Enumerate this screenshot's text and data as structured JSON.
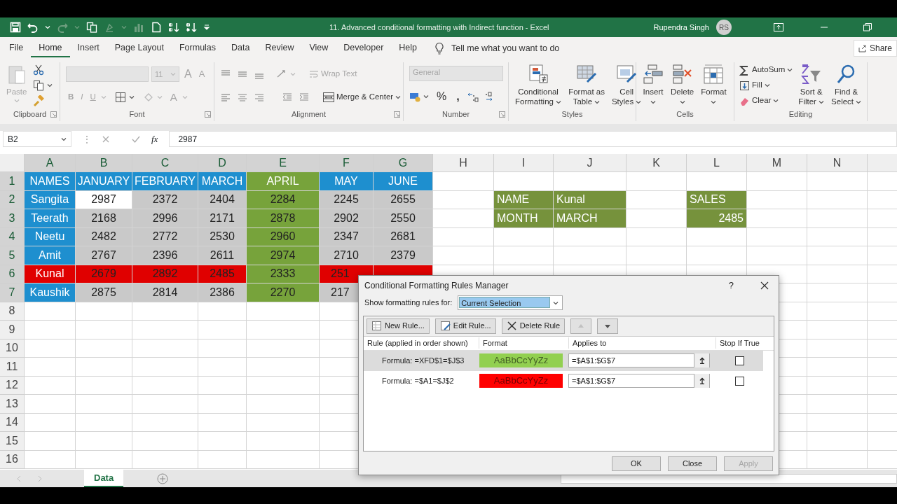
{
  "window": {
    "title": "11. Advanced conditional formatting with Indirect function  -  Excel",
    "user": "Rupendra Singh",
    "avatar": "RS"
  },
  "quick_access": [
    {
      "kind": "save",
      "disabled": false
    },
    {
      "kind": "undo",
      "disabled": false
    },
    {
      "kind": "caret",
      "disabled": false
    },
    {
      "kind": "redo",
      "disabled": true
    },
    {
      "kind": "caret",
      "disabled": true
    },
    {
      "kind": "copy",
      "disabled": false
    },
    {
      "kind": "brush",
      "disabled": true
    },
    {
      "kind": "caret",
      "disabled": true
    },
    {
      "kind": "chart",
      "disabled": true
    },
    {
      "kind": "page",
      "disabled": false
    },
    {
      "kind": "sort-up",
      "disabled": false
    },
    {
      "kind": "sort-down",
      "disabled": false
    },
    {
      "kind": "more",
      "disabled": false
    }
  ],
  "tabs": [
    {
      "label": "File",
      "selected": false
    },
    {
      "label": "Home",
      "selected": true
    },
    {
      "label": "Insert",
      "selected": false
    },
    {
      "label": "Page Layout",
      "selected": false
    },
    {
      "label": "Formulas",
      "selected": false
    },
    {
      "label": "Data",
      "selected": false
    },
    {
      "label": "Review",
      "selected": false
    },
    {
      "label": "View",
      "selected": false
    },
    {
      "label": "Developer",
      "selected": false
    },
    {
      "label": "Help",
      "selected": false
    }
  ],
  "tell_me": "Tell me what you want to do",
  "share": "Share",
  "ribbon": {
    "clipboard": {
      "label": "Clipboard",
      "paste": {
        "label": "Paste",
        "disabled": true
      }
    },
    "font": {
      "label": "Font",
      "size": "11",
      "grow": "A",
      "shrink": "A",
      "bold": "B",
      "italic": "I",
      "underline": "U",
      "font_color": "A"
    },
    "alignment": {
      "label": "Alignment",
      "wrap_text": {
        "label": "Wrap Text",
        "disabled": true
      },
      "merge": {
        "label": "Merge & Center",
        "disabled": false
      }
    },
    "number": {
      "label": "Number",
      "format": {
        "value": "General",
        "disabled": true
      },
      "percent": "%",
      "comma": ","
    },
    "styles": {
      "label": "Styles",
      "buttons": [
        {
          "kind": "conditional",
          "lines": [
            "Conditional",
            "Formatting"
          ]
        },
        {
          "kind": "table",
          "lines": [
            "Format as",
            "Table"
          ]
        },
        {
          "kind": "cellstyle",
          "lines": [
            "Cell",
            "Styles"
          ]
        }
      ]
    },
    "cells": {
      "label": "Cells",
      "buttons": [
        {
          "kind": "insert",
          "label": "Insert"
        },
        {
          "kind": "delete",
          "label": "Delete"
        },
        {
          "kind": "format",
          "label": "Format"
        }
      ]
    },
    "editing": {
      "label": "Editing",
      "small": [
        {
          "kind": "autosum",
          "label": "AutoSum"
        },
        {
          "kind": "fill",
          "label": "Fill"
        },
        {
          "kind": "clear",
          "label": "Clear"
        }
      ],
      "buttons": [
        {
          "kind": "sort",
          "lines": [
            "Sort &",
            "Filter"
          ]
        },
        {
          "kind": "find",
          "lines": [
            "Find &",
            "Select"
          ]
        }
      ]
    }
  },
  "formula_bar": {
    "name_box": "B2",
    "handle": "⋮",
    "fx": "fx",
    "value": "2987"
  },
  "sheet": {
    "columns": [
      {
        "label": "A",
        "selected": true
      },
      {
        "label": "B",
        "selected": true
      },
      {
        "label": "C",
        "selected": true
      },
      {
        "label": "D",
        "selected": true
      },
      {
        "label": "E",
        "selected": true
      },
      {
        "label": "F",
        "selected": true
      },
      {
        "label": "G",
        "selected": true
      },
      {
        "label": "H",
        "selected": false
      },
      {
        "label": "I",
        "selected": false
      },
      {
        "label": "J",
        "selected": false
      },
      {
        "label": "K",
        "selected": false
      },
      {
        "label": "L",
        "selected": false
      },
      {
        "label": "M",
        "selected": false
      },
      {
        "label": "N",
        "selected": false
      }
    ],
    "rows": [
      {
        "label": "1",
        "selected": true,
        "cells": [
          {
            "text": "NAMES",
            "kind": "head",
            "color": "#1e8fcf"
          },
          {
            "text": "JANUARY",
            "kind": "head",
            "color": "#1e8fcf"
          },
          {
            "text": "FEBRUARY",
            "kind": "head",
            "color": "#1e8fcf"
          },
          {
            "text": "MARCH",
            "kind": "head",
            "color": "#1e8fcf"
          },
          {
            "text": "APRIL",
            "kind": "head",
            "color": "#77a33b"
          },
          {
            "text": "MAY",
            "kind": "head",
            "color": "#1e8fcf"
          },
          {
            "text": "JUNE",
            "kind": "head",
            "color": "#1e8fcf"
          }
        ]
      },
      {
        "label": "2",
        "selected": true,
        "cells": [
          {
            "text": "Sangita",
            "kind": "head",
            "color": "#1e8fcf"
          },
          {
            "text": "2987",
            "kind": "num",
            "color": "#ffffff"
          },
          {
            "text": "2372",
            "kind": "num",
            "color": "#c9c9c9"
          },
          {
            "text": "2404",
            "kind": "num",
            "color": "#c9c9c9"
          },
          {
            "text": "2284",
            "kind": "num",
            "color": "#77a33b"
          },
          {
            "text": "2245",
            "kind": "num",
            "color": "#c9c9c9"
          },
          {
            "text": "2655",
            "kind": "num",
            "color": "#c9c9c9"
          },
          {},
          {
            "text": "NAME",
            "kind": "text",
            "color": "#76923c"
          },
          {
            "text": "Kunal",
            "kind": "text",
            "color": "#76923c"
          },
          {},
          {
            "text": "SALES",
            "kind": "text",
            "color": "#76923c"
          }
        ]
      },
      {
        "label": "3",
        "selected": true,
        "cells": [
          {
            "text": "Teerath",
            "kind": "head",
            "color": "#1e8fcf"
          },
          {
            "text": "2168",
            "kind": "num",
            "color": "#c9c9c9"
          },
          {
            "text": "2996",
            "kind": "num",
            "color": "#c9c9c9"
          },
          {
            "text": "2171",
            "kind": "num",
            "color": "#c9c9c9"
          },
          {
            "text": "2878",
            "kind": "num",
            "color": "#77a33b"
          },
          {
            "text": "2902",
            "kind": "num",
            "color": "#c9c9c9"
          },
          {
            "text": "2550",
            "kind": "num",
            "color": "#c9c9c9"
          },
          {},
          {
            "text": "MONTH",
            "kind": "text",
            "color": "#76923c"
          },
          {
            "text": "MARCH",
            "kind": "text",
            "color": "#76923c"
          },
          {},
          {
            "text": "2485",
            "kind": "value",
            "color": "#76923c"
          }
        ]
      },
      {
        "label": "4",
        "selected": true,
        "cells": [
          {
            "text": "Neetu",
            "kind": "head",
            "color": "#1e8fcf"
          },
          {
            "text": "2482",
            "kind": "num",
            "color": "#c9c9c9"
          },
          {
            "text": "2772",
            "kind": "num",
            "color": "#c9c9c9"
          },
          {
            "text": "2530",
            "kind": "num",
            "color": "#c9c9c9"
          },
          {
            "text": "2960",
            "kind": "num",
            "color": "#77a33b"
          },
          {
            "text": "2347",
            "kind": "num",
            "color": "#c9c9c9"
          },
          {
            "text": "2681",
            "kind": "num",
            "color": "#c9c9c9"
          }
        ]
      },
      {
        "label": "5",
        "selected": true,
        "cells": [
          {
            "text": "Amit",
            "kind": "head",
            "color": "#1e8fcf"
          },
          {
            "text": "2767",
            "kind": "num",
            "color": "#c9c9c9"
          },
          {
            "text": "2396",
            "kind": "num",
            "color": "#c9c9c9"
          },
          {
            "text": "2611",
            "kind": "num",
            "color": "#c9c9c9"
          },
          {
            "text": "2974",
            "kind": "num",
            "color": "#77a33b"
          },
          {
            "text": "2710",
            "kind": "num",
            "color": "#c9c9c9"
          },
          {
            "text": "2379",
            "kind": "num",
            "color": "#c9c9c9"
          }
        ]
      },
      {
        "label": "6",
        "selected": true,
        "cells": [
          {
            "text": "Kunal",
            "kind": "head",
            "color": "#e00000"
          },
          {
            "text": "2679",
            "kind": "num",
            "color": "#e00000"
          },
          {
            "text": "2892",
            "kind": "num",
            "color": "#e00000"
          },
          {
            "text": "2485",
            "kind": "num",
            "color": "#e00000"
          },
          {
            "text": "2333",
            "kind": "num",
            "color": "#77a33b"
          },
          {
            "text": "251",
            "kind": "cut",
            "color": "#e00000"
          },
          {
            "kind": "num",
            "color": "#e00000"
          }
        ]
      },
      {
        "label": "7",
        "selected": true,
        "cells": [
          {
            "text": "Kaushik",
            "kind": "head",
            "color": "#1e8fcf"
          },
          {
            "text": "2875",
            "kind": "num",
            "color": "#c9c9c9"
          },
          {
            "text": "2814",
            "kind": "num",
            "color": "#c9c9c9"
          },
          {
            "text": "2386",
            "kind": "num",
            "color": "#c9c9c9"
          },
          {
            "text": "2270",
            "kind": "num",
            "color": "#77a33b"
          },
          {
            "text": "217",
            "kind": "cut",
            "color": "#c9c9c9"
          }
        ]
      },
      {
        "label": "8",
        "selected": false
      },
      {
        "label": "9",
        "selected": false
      },
      {
        "label": "10",
        "selected": false
      },
      {
        "label": "11",
        "selected": false
      },
      {
        "label": "12",
        "selected": false
      },
      {
        "label": "13",
        "selected": false
      },
      {
        "label": "14",
        "selected": false
      },
      {
        "label": "15",
        "selected": false
      },
      {
        "label": "16",
        "selected": false
      }
    ]
  },
  "sheet_tabs": [
    {
      "label": "Data",
      "selected": true
    }
  ],
  "dialog": {
    "title": "Conditional Formatting Rules Manager",
    "help": "?",
    "show_label": "Show formatting rules for:",
    "scope": "Current Selection",
    "toolbar": [
      {
        "kind": "new",
        "label": "New Rule...",
        "disabled": false
      },
      {
        "kind": "edit",
        "label": "Edit Rule...",
        "disabled": false
      },
      {
        "kind": "delete",
        "label": "Delete Rule",
        "disabled": false
      },
      {
        "kind": "up",
        "disabled": true
      },
      {
        "kind": "down",
        "disabled": false
      }
    ],
    "columns": [
      "Rule (applied in order shown)",
      "Format",
      "Applies to",
      "Stop If True"
    ],
    "rules": [
      {
        "rule": "Formula: =XFD$1=$J$3",
        "preview": "AaBbCcYyZz",
        "color": "#92d050",
        "applies_to": "=$A$1:$G$7",
        "stop_if_true": false,
        "selected": true
      },
      {
        "rule": "Formula: =$A1=$J$2",
        "preview": "AaBbCcYyZz",
        "color": "#ff0000",
        "applies_to": "=$A$1:$G$7",
        "stop_if_true": false,
        "selected": false
      }
    ],
    "buttons": [
      {
        "label": "OK",
        "disabled": false
      },
      {
        "label": "Close",
        "disabled": false
      },
      {
        "label": "Apply",
        "disabled": true
      }
    ]
  }
}
